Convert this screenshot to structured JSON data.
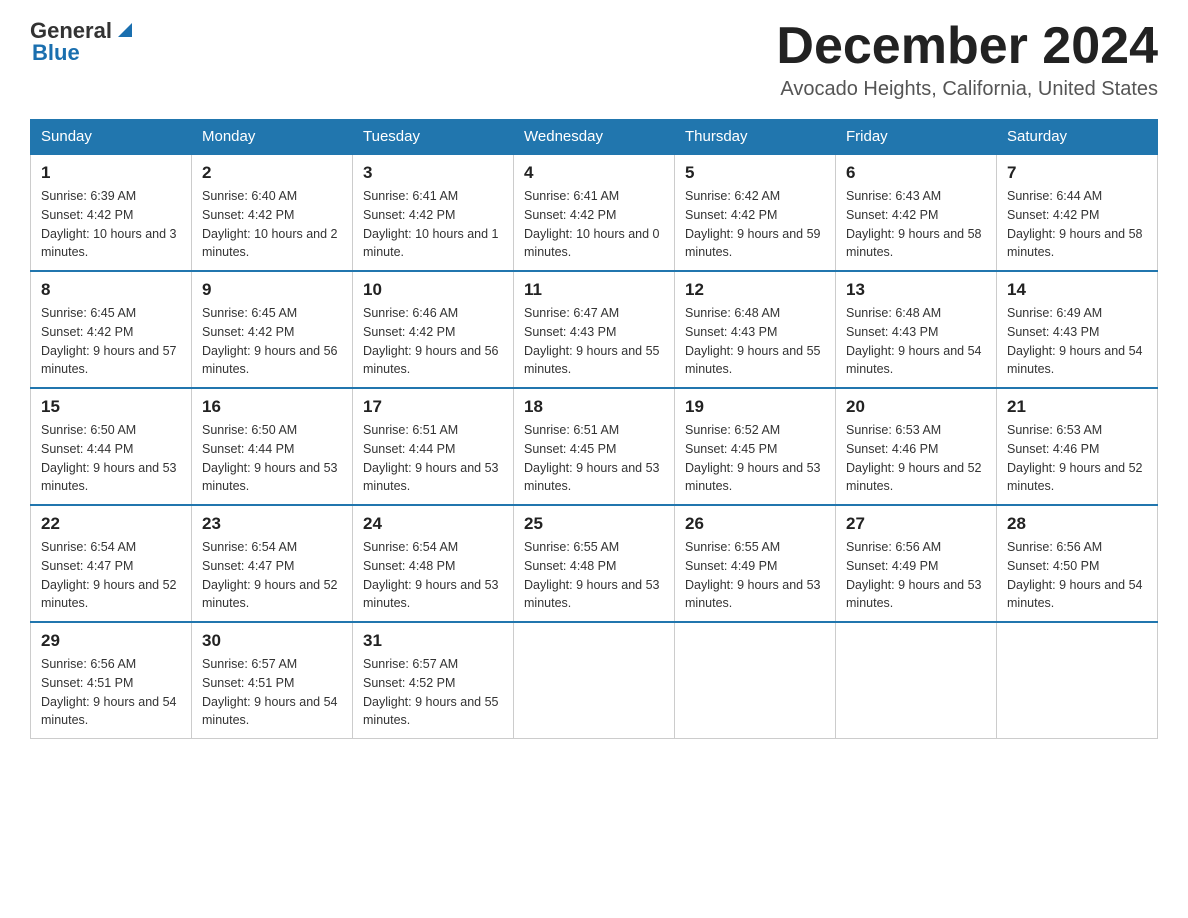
{
  "header": {
    "logo_general": "General",
    "logo_blue": "Blue",
    "month_title": "December 2024",
    "location": "Avocado Heights, California, United States"
  },
  "days_of_week": [
    "Sunday",
    "Monday",
    "Tuesday",
    "Wednesday",
    "Thursday",
    "Friday",
    "Saturday"
  ],
  "weeks": [
    [
      {
        "day": "1",
        "sunrise": "6:39 AM",
        "sunset": "4:42 PM",
        "daylight": "10 hours and 3 minutes."
      },
      {
        "day": "2",
        "sunrise": "6:40 AM",
        "sunset": "4:42 PM",
        "daylight": "10 hours and 2 minutes."
      },
      {
        "day": "3",
        "sunrise": "6:41 AM",
        "sunset": "4:42 PM",
        "daylight": "10 hours and 1 minute."
      },
      {
        "day": "4",
        "sunrise": "6:41 AM",
        "sunset": "4:42 PM",
        "daylight": "10 hours and 0 minutes."
      },
      {
        "day": "5",
        "sunrise": "6:42 AM",
        "sunset": "4:42 PM",
        "daylight": "9 hours and 59 minutes."
      },
      {
        "day": "6",
        "sunrise": "6:43 AM",
        "sunset": "4:42 PM",
        "daylight": "9 hours and 58 minutes."
      },
      {
        "day": "7",
        "sunrise": "6:44 AM",
        "sunset": "4:42 PM",
        "daylight": "9 hours and 58 minutes."
      }
    ],
    [
      {
        "day": "8",
        "sunrise": "6:45 AM",
        "sunset": "4:42 PM",
        "daylight": "9 hours and 57 minutes."
      },
      {
        "day": "9",
        "sunrise": "6:45 AM",
        "sunset": "4:42 PM",
        "daylight": "9 hours and 56 minutes."
      },
      {
        "day": "10",
        "sunrise": "6:46 AM",
        "sunset": "4:42 PM",
        "daylight": "9 hours and 56 minutes."
      },
      {
        "day": "11",
        "sunrise": "6:47 AM",
        "sunset": "4:43 PM",
        "daylight": "9 hours and 55 minutes."
      },
      {
        "day": "12",
        "sunrise": "6:48 AM",
        "sunset": "4:43 PM",
        "daylight": "9 hours and 55 minutes."
      },
      {
        "day": "13",
        "sunrise": "6:48 AM",
        "sunset": "4:43 PM",
        "daylight": "9 hours and 54 minutes."
      },
      {
        "day": "14",
        "sunrise": "6:49 AM",
        "sunset": "4:43 PM",
        "daylight": "9 hours and 54 minutes."
      }
    ],
    [
      {
        "day": "15",
        "sunrise": "6:50 AM",
        "sunset": "4:44 PM",
        "daylight": "9 hours and 53 minutes."
      },
      {
        "day": "16",
        "sunrise": "6:50 AM",
        "sunset": "4:44 PM",
        "daylight": "9 hours and 53 minutes."
      },
      {
        "day": "17",
        "sunrise": "6:51 AM",
        "sunset": "4:44 PM",
        "daylight": "9 hours and 53 minutes."
      },
      {
        "day": "18",
        "sunrise": "6:51 AM",
        "sunset": "4:45 PM",
        "daylight": "9 hours and 53 minutes."
      },
      {
        "day": "19",
        "sunrise": "6:52 AM",
        "sunset": "4:45 PM",
        "daylight": "9 hours and 53 minutes."
      },
      {
        "day": "20",
        "sunrise": "6:53 AM",
        "sunset": "4:46 PM",
        "daylight": "9 hours and 52 minutes."
      },
      {
        "day": "21",
        "sunrise": "6:53 AM",
        "sunset": "4:46 PM",
        "daylight": "9 hours and 52 minutes."
      }
    ],
    [
      {
        "day": "22",
        "sunrise": "6:54 AM",
        "sunset": "4:47 PM",
        "daylight": "9 hours and 52 minutes."
      },
      {
        "day": "23",
        "sunrise": "6:54 AM",
        "sunset": "4:47 PM",
        "daylight": "9 hours and 52 minutes."
      },
      {
        "day": "24",
        "sunrise": "6:54 AM",
        "sunset": "4:48 PM",
        "daylight": "9 hours and 53 minutes."
      },
      {
        "day": "25",
        "sunrise": "6:55 AM",
        "sunset": "4:48 PM",
        "daylight": "9 hours and 53 minutes."
      },
      {
        "day": "26",
        "sunrise": "6:55 AM",
        "sunset": "4:49 PM",
        "daylight": "9 hours and 53 minutes."
      },
      {
        "day": "27",
        "sunrise": "6:56 AM",
        "sunset": "4:49 PM",
        "daylight": "9 hours and 53 minutes."
      },
      {
        "day": "28",
        "sunrise": "6:56 AM",
        "sunset": "4:50 PM",
        "daylight": "9 hours and 54 minutes."
      }
    ],
    [
      {
        "day": "29",
        "sunrise": "6:56 AM",
        "sunset": "4:51 PM",
        "daylight": "9 hours and 54 minutes."
      },
      {
        "day": "30",
        "sunrise": "6:57 AM",
        "sunset": "4:51 PM",
        "daylight": "9 hours and 54 minutes."
      },
      {
        "day": "31",
        "sunrise": "6:57 AM",
        "sunset": "4:52 PM",
        "daylight": "9 hours and 55 minutes."
      },
      null,
      null,
      null,
      null
    ]
  ]
}
